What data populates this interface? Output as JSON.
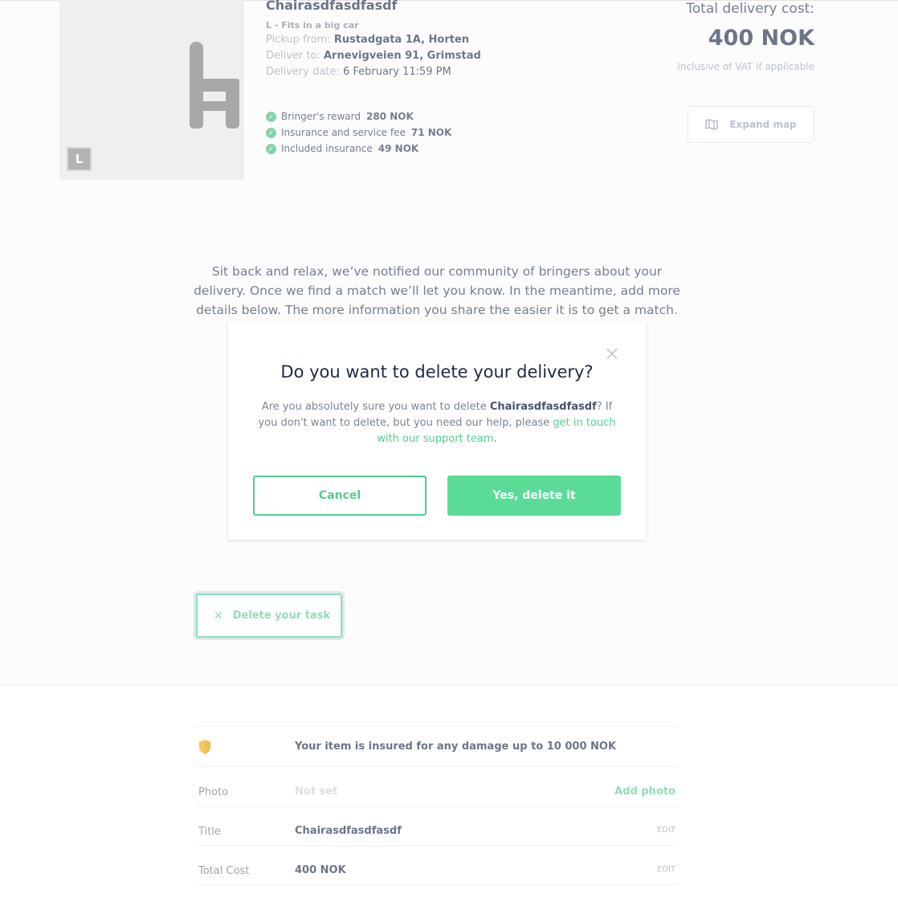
{
  "delivery": {
    "title": "Chairasdfasdfasdf",
    "size_badge": "L",
    "size_desc": "L - Fits in a big car",
    "pickup_label": "Pickup from:",
    "pickup_value": "Rustadgata 1A, Horten",
    "deliver_label": "Deliver to:",
    "deliver_value": "Arnevigveien 91, Grimstad",
    "date_label": "Delivery date:",
    "date_value": "6 February 11:59 PM"
  },
  "fees": [
    {
      "label": "Bringer's reward",
      "amount": "280 NOK"
    },
    {
      "label": "Insurance and service fee",
      "amount": "71 NOK"
    },
    {
      "label": "Included insurance",
      "amount": "49 NOK"
    }
  ],
  "cost": {
    "label": "Total delivery cost:",
    "value": "400 NOK",
    "vat_note": "Inclusive of VAT if applicable"
  },
  "map": {
    "expand_label": "Expand map"
  },
  "message": "Sit back and relax, we’ve notified our community of bringers about your delivery. Once we find a match we’ll let you know. In the meantime, add more details below. The more information you share the easier it is to get a match.",
  "delete_task_label": "Delete your task",
  "info": {
    "insurance_text": "Your item is insured for any damage up to 10 000 NOK",
    "rows": [
      {
        "label": "Photo",
        "value": "Not set",
        "action": "Add photo"
      },
      {
        "label": "Title",
        "value": "Chairasdfasdfasdf",
        "action": "EDIT"
      },
      {
        "label": "Total Cost",
        "value": "400 NOK",
        "action": "EDIT"
      }
    ]
  },
  "modal": {
    "title": "Do you want to delete your delivery?",
    "body_pre": "Are you absolutely sure you want to delete ",
    "body_item": "Chairasdfasdfasdf",
    "body_post": "? If you don't want to delete, but you need our help, please ",
    "body_link": "get in touch with our support team",
    "body_end": ".",
    "cancel_label": "Cancel",
    "confirm_label": "Yes, delete it",
    "close_glyph": "×"
  },
  "colors": {
    "accent_green": "#4fd08c",
    "confirm_green": "#5bdb98",
    "navy": "#1d2b45",
    "shield": "#f2a900"
  },
  "icons": {
    "item": "chair-icon",
    "check": "check-icon",
    "map": "map-icon",
    "close": "close-icon",
    "delete": "x-icon",
    "insurance": "shield-icon"
  }
}
